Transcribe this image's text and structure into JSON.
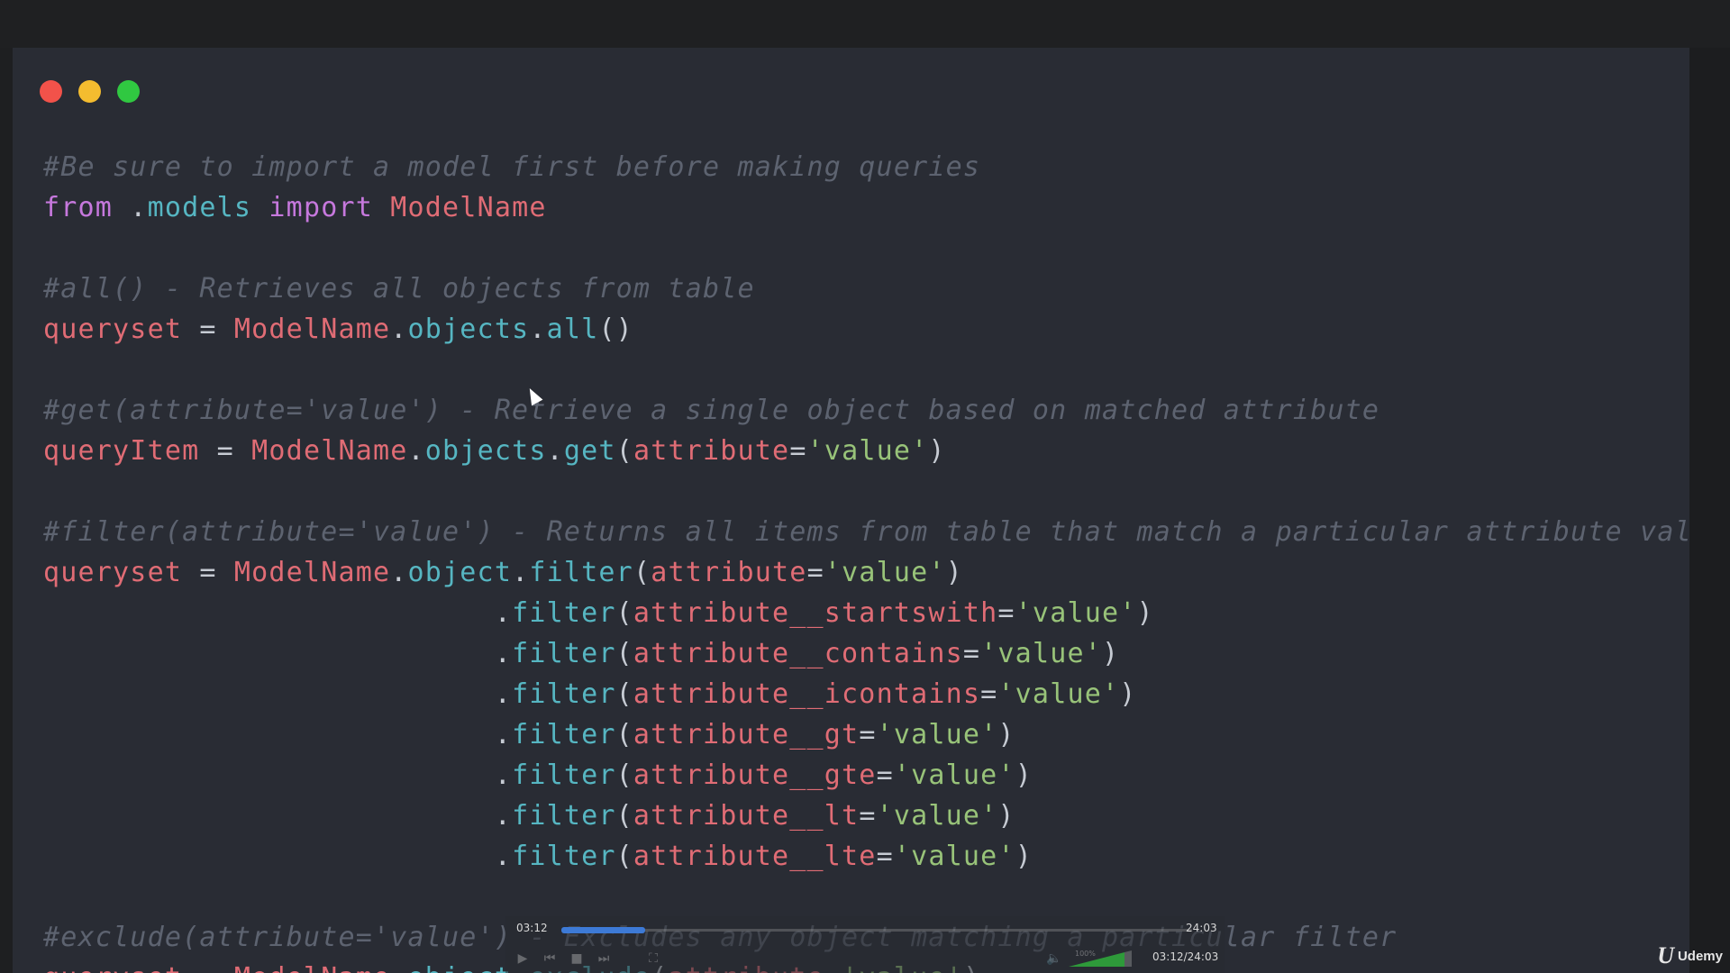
{
  "window": {
    "buttons": [
      "close",
      "minimize",
      "maximize"
    ]
  },
  "code": {
    "lines": [
      [
        {
          "t": "#Be sure to import a model first before making queries",
          "c": "comment"
        }
      ],
      [
        {
          "t": "from",
          "c": "kw"
        },
        {
          "t": " .",
          "c": "punct"
        },
        {
          "t": "models",
          "c": "meth"
        },
        {
          "t": " ",
          "c": "punct"
        },
        {
          "t": "import",
          "c": "kw"
        },
        {
          "t": " ",
          "c": "punct"
        },
        {
          "t": "ModelName",
          "c": "ident"
        }
      ],
      [],
      [
        {
          "t": "#all() - Retrieves all objects from table",
          "c": "comment"
        }
      ],
      [
        {
          "t": "queryset",
          "c": "ident"
        },
        {
          "t": " = ",
          "c": "punct"
        },
        {
          "t": "ModelName",
          "c": "ident"
        },
        {
          "t": ".",
          "c": "punct"
        },
        {
          "t": "objects",
          "c": "meth"
        },
        {
          "t": ".",
          "c": "punct"
        },
        {
          "t": "all",
          "c": "meth"
        },
        {
          "t": "()",
          "c": "punct"
        }
      ],
      [],
      [
        {
          "t": "#get(attribute='value') - Retrieve a single object based on matched attribute",
          "c": "comment"
        }
      ],
      [
        {
          "t": "queryItem",
          "c": "ident"
        },
        {
          "t": " = ",
          "c": "punct"
        },
        {
          "t": "ModelName",
          "c": "ident"
        },
        {
          "t": ".",
          "c": "punct"
        },
        {
          "t": "objects",
          "c": "meth"
        },
        {
          "t": ".",
          "c": "punct"
        },
        {
          "t": "get",
          "c": "meth"
        },
        {
          "t": "(",
          "c": "punct"
        },
        {
          "t": "attribute",
          "c": "ident"
        },
        {
          "t": "=",
          "c": "punct"
        },
        {
          "t": "'value'",
          "c": "str"
        },
        {
          "t": ")",
          "c": "punct"
        }
      ],
      [],
      [
        {
          "t": "#filter(attribute='value') - Returns all items from table that match a particular attribute value",
          "c": "comment"
        }
      ],
      [
        {
          "t": "queryset",
          "c": "ident"
        },
        {
          "t": " = ",
          "c": "punct"
        },
        {
          "t": "ModelName",
          "c": "ident"
        },
        {
          "t": ".",
          "c": "punct"
        },
        {
          "t": "object",
          "c": "meth"
        },
        {
          "t": ".",
          "c": "punct"
        },
        {
          "t": "filter",
          "c": "meth"
        },
        {
          "t": "(",
          "c": "punct"
        },
        {
          "t": "attribute",
          "c": "ident"
        },
        {
          "t": "=",
          "c": "punct"
        },
        {
          "t": "'value'",
          "c": "str"
        },
        {
          "t": ")",
          "c": "punct"
        }
      ],
      [
        {
          "t": "                          .",
          "c": "punct"
        },
        {
          "t": "filter",
          "c": "meth"
        },
        {
          "t": "(",
          "c": "punct"
        },
        {
          "t": "attribute__startswith",
          "c": "ident"
        },
        {
          "t": "=",
          "c": "punct"
        },
        {
          "t": "'value'",
          "c": "str"
        },
        {
          "t": ")",
          "c": "punct"
        }
      ],
      [
        {
          "t": "                          .",
          "c": "punct"
        },
        {
          "t": "filter",
          "c": "meth"
        },
        {
          "t": "(",
          "c": "punct"
        },
        {
          "t": "attribute__contains",
          "c": "ident"
        },
        {
          "t": "=",
          "c": "punct"
        },
        {
          "t": "'value'",
          "c": "str"
        },
        {
          "t": ")",
          "c": "punct"
        }
      ],
      [
        {
          "t": "                          .",
          "c": "punct"
        },
        {
          "t": "filter",
          "c": "meth"
        },
        {
          "t": "(",
          "c": "punct"
        },
        {
          "t": "attribute__icontains",
          "c": "ident"
        },
        {
          "t": "=",
          "c": "punct"
        },
        {
          "t": "'value'",
          "c": "str"
        },
        {
          "t": ")",
          "c": "punct"
        }
      ],
      [
        {
          "t": "                          .",
          "c": "punct"
        },
        {
          "t": "filter",
          "c": "meth"
        },
        {
          "t": "(",
          "c": "punct"
        },
        {
          "t": "attribute__gt",
          "c": "ident"
        },
        {
          "t": "=",
          "c": "punct"
        },
        {
          "t": "'value'",
          "c": "str"
        },
        {
          "t": ")",
          "c": "punct"
        }
      ],
      [
        {
          "t": "                          .",
          "c": "punct"
        },
        {
          "t": "filter",
          "c": "meth"
        },
        {
          "t": "(",
          "c": "punct"
        },
        {
          "t": "attribute__gte",
          "c": "ident"
        },
        {
          "t": "=",
          "c": "punct"
        },
        {
          "t": "'value'",
          "c": "str"
        },
        {
          "t": ")",
          "c": "punct"
        }
      ],
      [
        {
          "t": "                          .",
          "c": "punct"
        },
        {
          "t": "filter",
          "c": "meth"
        },
        {
          "t": "(",
          "c": "punct"
        },
        {
          "t": "attribute__lt",
          "c": "ident"
        },
        {
          "t": "=",
          "c": "punct"
        },
        {
          "t": "'value'",
          "c": "str"
        },
        {
          "t": ")",
          "c": "punct"
        }
      ],
      [
        {
          "t": "                          .",
          "c": "punct"
        },
        {
          "t": "filter",
          "c": "meth"
        },
        {
          "t": "(",
          "c": "punct"
        },
        {
          "t": "attribute__lte",
          "c": "ident"
        },
        {
          "t": "=",
          "c": "punct"
        },
        {
          "t": "'value'",
          "c": "str"
        },
        {
          "t": ")",
          "c": "punct"
        }
      ],
      [],
      [
        {
          "t": "#exclude(attribute='value') - Excludes any object matching a particular filter",
          "c": "comment"
        }
      ],
      [
        {
          "t": "queryset",
          "c": "ident"
        },
        {
          "t": " = ",
          "c": "punct"
        },
        {
          "t": "ModelName",
          "c": "ident"
        },
        {
          "t": ".",
          "c": "punct"
        },
        {
          "t": "object",
          "c": "meth"
        },
        {
          "t": ".",
          "c": "punct"
        },
        {
          "t": "exclude",
          "c": "meth"
        },
        {
          "t": "(",
          "c": "punct"
        },
        {
          "t": "attribute",
          "c": "ident"
        },
        {
          "t": "=",
          "c": "punct"
        },
        {
          "t": "'value'",
          "c": "str"
        },
        {
          "t": ")",
          "c": "punct"
        }
      ]
    ]
  },
  "player": {
    "current_time": "03:12",
    "total_time": "24:03",
    "time_readout": "03:12/24:03",
    "progress_fraction": 0.133,
    "volume_label": "100%"
  },
  "brand": {
    "name": "Udemy",
    "mark": "U"
  },
  "colors": {
    "editor_bg": "#292c34",
    "comment": "#5d6370",
    "keyword": "#c678dd",
    "identifier": "#e06c75",
    "method": "#56b6c2",
    "string": "#98c379",
    "progress": "#3d7ad6"
  },
  "icons": [
    "play-icon",
    "prev-icon",
    "stop-icon",
    "next-icon",
    "fullscreen-icon",
    "speaker-icon"
  ]
}
